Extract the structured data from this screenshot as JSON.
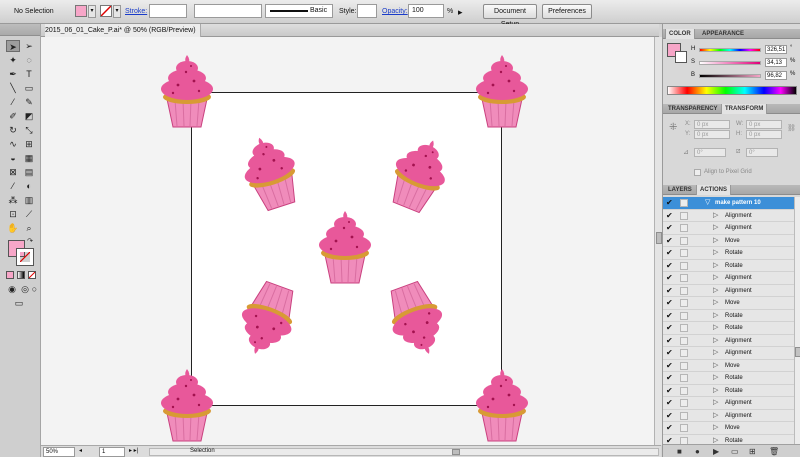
{
  "control_bar": {
    "selection_label": "No Selection",
    "fill_color": "#f7a6c8",
    "stroke_label": "Stroke:",
    "stroke_profile": "Basic",
    "style_label": "Style:",
    "opacity_label": "Opacity:",
    "opacity_value": "100",
    "opacity_unit": "%",
    "document_setup": "Document Setup",
    "preferences": "Preferences"
  },
  "document": {
    "tab_title": "2015_06_01_Cake_P.ai* @ 50% (RGB/Preview)"
  },
  "cupcakes": {
    "count": 9,
    "icon": "cupcake-illustration",
    "frosting_color": "#e8589a",
    "wrapper_color": "#f08cbb",
    "sprinkle_color": "#d89a35"
  },
  "status_bar": {
    "zoom": "50%",
    "artboard": "1",
    "tool": "Selection"
  },
  "color_panel": {
    "tabs": [
      "COLOR",
      "APPEARANCE"
    ],
    "active_tab": "COLOR",
    "fill_color": "#f7a6c8",
    "channels": [
      {
        "label": "H",
        "value": "326,51",
        "unit": "°"
      },
      {
        "label": "S",
        "value": "34,13",
        "unit": "%"
      },
      {
        "label": "B",
        "value": "96,82",
        "unit": "%"
      }
    ]
  },
  "transform_panel": {
    "tabs": [
      "TRANSPARENCY",
      "TRANSFORM"
    ],
    "active_tab": "TRANSFORM",
    "x_label": "X:",
    "x_value": "0 px",
    "y_label": "Y:",
    "y_value": "0 px",
    "w_label": "W:",
    "w_value": "0 px",
    "h_label": "H:",
    "h_value": "0 px",
    "rotate_value": "0°",
    "shear_value": "0°",
    "align_pixel_grid": "Align to Pixel Grid"
  },
  "actions_panel": {
    "tabs": [
      "LAYERS",
      "ACTIONS"
    ],
    "active_tab": "ACTIONS",
    "set_name": "make pattern 10",
    "items": [
      "Alignment",
      "Alignment",
      "Move",
      "Rotate",
      "Rotate",
      "Alignment",
      "Alignment",
      "Move",
      "Rotate",
      "Rotate",
      "Alignment",
      "Alignment",
      "Move",
      "Rotate",
      "Rotate",
      "Alignment",
      "Alignment",
      "Move",
      "Rotate"
    ]
  }
}
